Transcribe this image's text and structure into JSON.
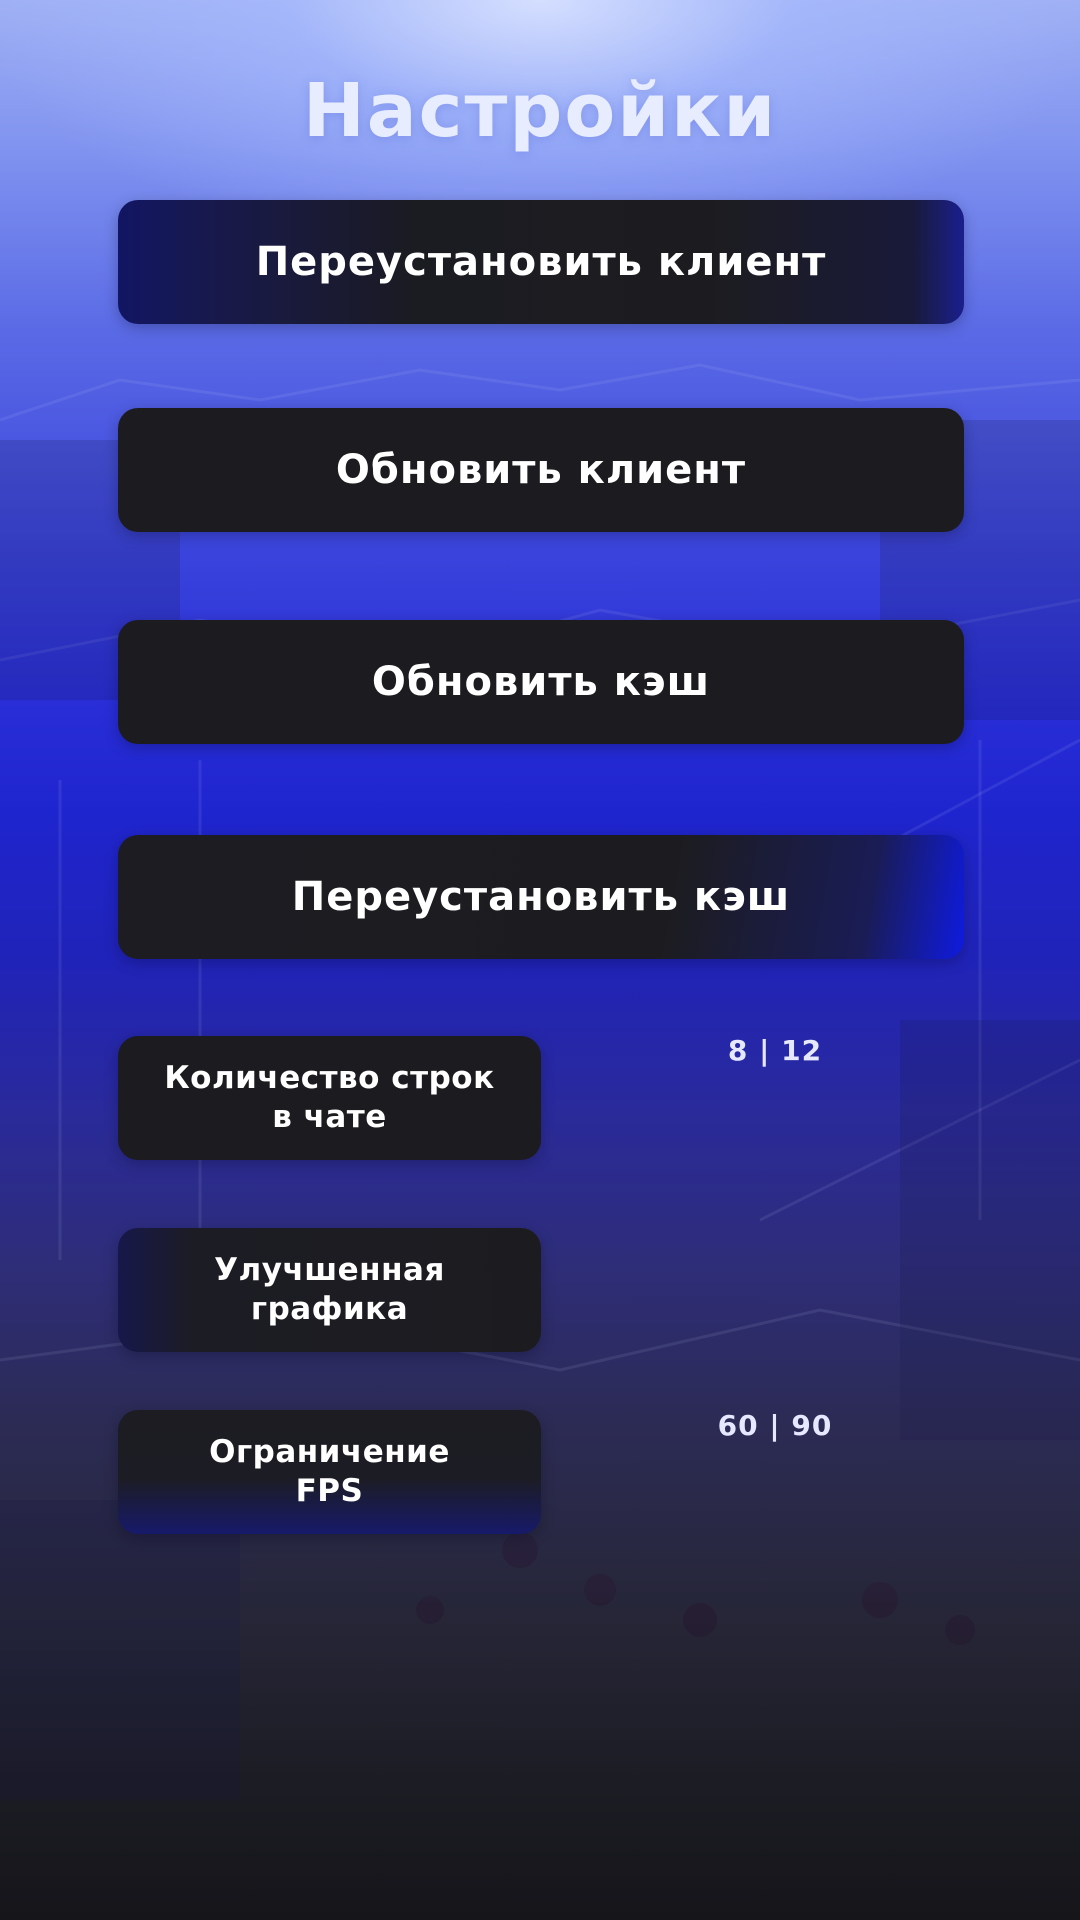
{
  "screen": {
    "title": "Настройки"
  },
  "buttons": {
    "reinstall_client": "Переустановить клиент",
    "update_client": "Обновить клиент",
    "update_cache": "Обновить кэш",
    "reinstall_cache": "Переустановить кэш"
  },
  "settings": {
    "chat_lines": {
      "label_line1": "Количество строк",
      "label_line2": "в чате",
      "value": "8 | 12"
    },
    "graphics": {
      "label_line1": "Улучшенная",
      "label_line2": "графика"
    },
    "fps_limit": {
      "label_line1": "Ограничение",
      "label_line2": "FPS",
      "value": "60 | 90"
    }
  },
  "colors": {
    "background_top": "#9fb0f4",
    "background_mid": "#1f25cf",
    "background_bottom": "#15151a",
    "button": "#1c1c20",
    "accent_blue": "#0f1be0",
    "text": "#ffffff"
  }
}
